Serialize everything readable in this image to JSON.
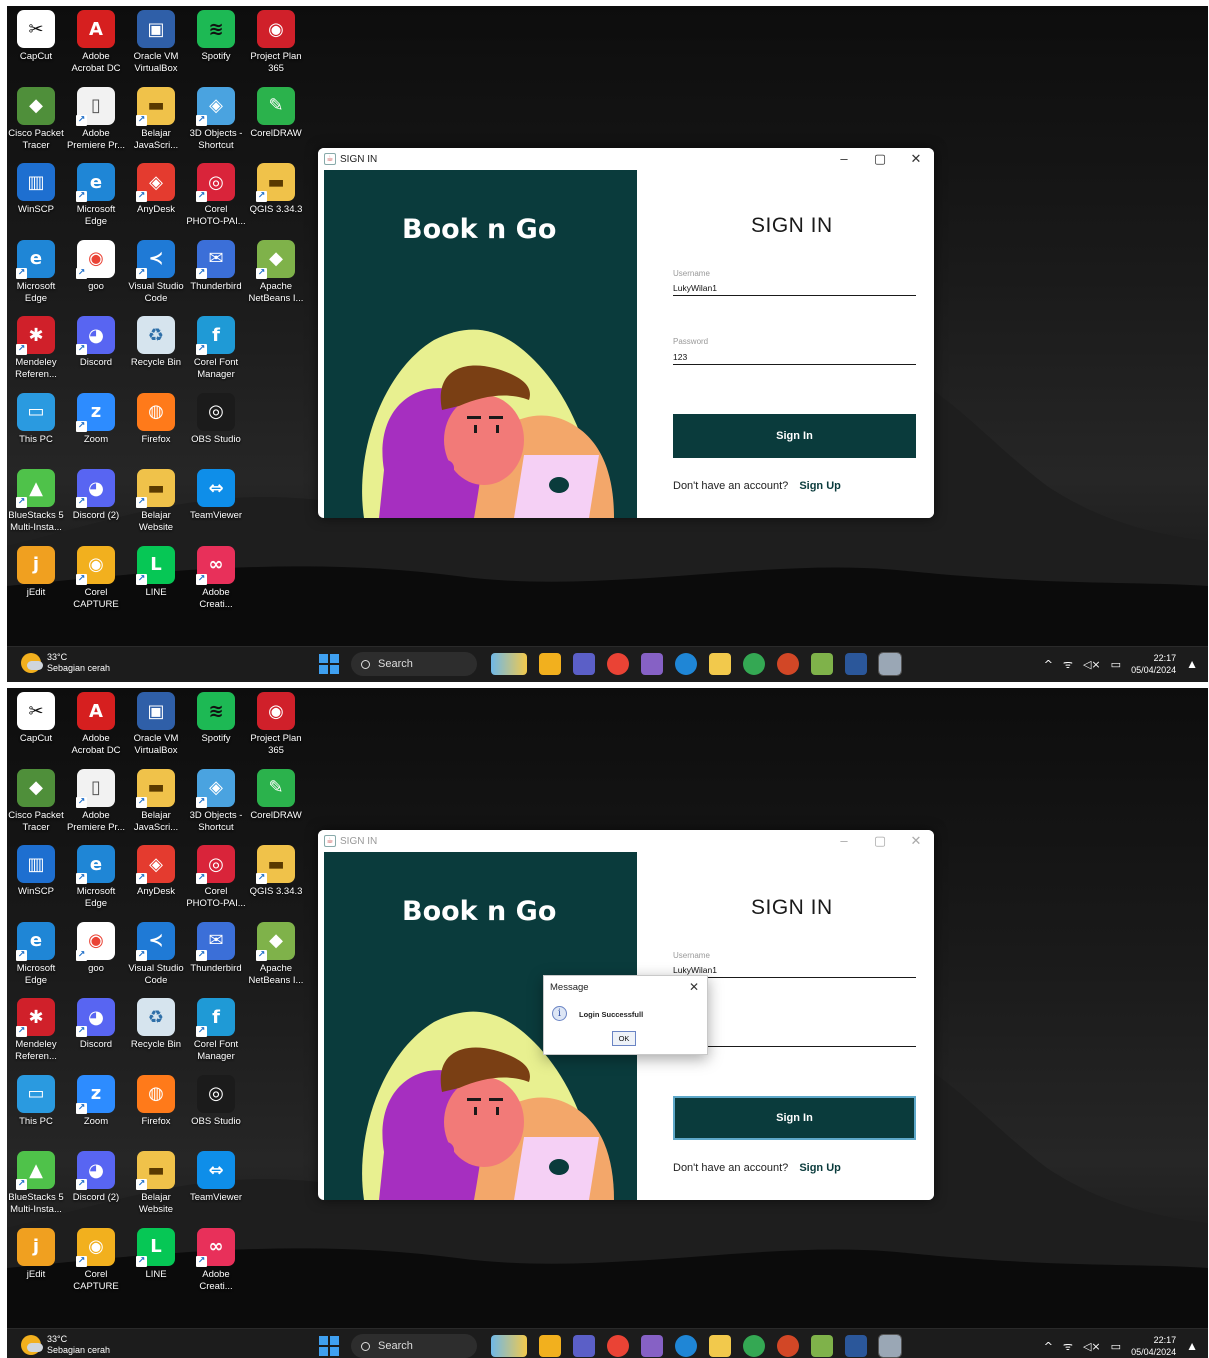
{
  "desktop": {
    "icons": [
      {
        "label": "CapCut",
        "color": "#ffffff",
        "fg": "#111111",
        "glyph": "✂"
      },
      {
        "label": "Adobe\nAcrobat DC",
        "color": "#d61f1f",
        "fg": "#ffffff",
        "glyph": "A"
      },
      {
        "label": "Oracle VM\nVirtualBox",
        "color": "#2f5fa8",
        "fg": "#ffffff",
        "glyph": "▣"
      },
      {
        "label": "Spotify",
        "color": "#1db954",
        "fg": "#111111",
        "glyph": "≋"
      },
      {
        "label": "Project Plan\n365",
        "color": "#d0202a",
        "fg": "#ffffff",
        "glyph": "◉"
      },
      {
        "label": "Cisco Packet\nTracer",
        "color": "#4f8f3a",
        "fg": "#ffffff",
        "glyph": "◆"
      },
      {
        "label": "Adobe\nPremiere Pr...",
        "color": "#f2f2f2",
        "fg": "#555555",
        "glyph": "▯"
      },
      {
        "label": "Belajar\nJavaScri...",
        "color": "#f0c24a",
        "fg": "#5a3a00",
        "glyph": "▬"
      },
      {
        "label": "3D Objects -\nShortcut",
        "color": "#4aa3e0",
        "fg": "#ffffff",
        "glyph": "◈"
      },
      {
        "label": "CorelDRAW",
        "color": "#2bb24c",
        "fg": "#ffffff",
        "glyph": "✎"
      },
      {
        "label": "WinSCP",
        "color": "#1e6fd0",
        "fg": "#ffffff",
        "glyph": "▥"
      },
      {
        "label": "Microsoft\nEdge",
        "color": "#1f86d6",
        "fg": "#ffffff",
        "glyph": "e"
      },
      {
        "label": "AnyDesk",
        "color": "#e43b2f",
        "fg": "#ffffff",
        "glyph": "◈"
      },
      {
        "label": "Corel\nPHOTO-PAI...",
        "color": "#d9243a",
        "fg": "#ffffff",
        "glyph": "◎"
      },
      {
        "label": "QGIS 3.34.3",
        "color": "#f0c24a",
        "fg": "#5a3a00",
        "glyph": "▬"
      },
      {
        "label": "Microsoft\nEdge",
        "color": "#1f86d6",
        "fg": "#ffffff",
        "glyph": "e"
      },
      {
        "label": "goo",
        "color": "#ffffff",
        "fg": "#ea4335",
        "glyph": "◉"
      },
      {
        "label": "Visual Studio\nCode",
        "color": "#1f7ad6",
        "fg": "#ffffff",
        "glyph": "≺"
      },
      {
        "label": "Thunderbird",
        "color": "#3b6fd8",
        "fg": "#ffffff",
        "glyph": "✉"
      },
      {
        "label": "Apache\nNetBeans I...",
        "color": "#7fb24a",
        "fg": "#ffffff",
        "glyph": "◆"
      },
      {
        "label": "Mendeley\nReferen...",
        "color": "#d0202a",
        "fg": "#ffffff",
        "glyph": "✱"
      },
      {
        "label": "Discord",
        "color": "#5865f2",
        "fg": "#ffffff",
        "glyph": "◕"
      },
      {
        "label": "Recycle Bin",
        "color": "#d6e4ee",
        "fg": "#2f6fa8",
        "glyph": "♻"
      },
      {
        "label": "Corel Font\nManager",
        "color": "#1f9ad6",
        "fg": "#ffffff",
        "glyph": "f"
      },
      {
        "label": "This PC",
        "color": "#2a9ae0",
        "fg": "#ffffff",
        "glyph": "▭"
      },
      {
        "label": "Zoom",
        "color": "#2d8cff",
        "fg": "#ffffff",
        "glyph": "z"
      },
      {
        "label": "Firefox",
        "color": "#ff7a1a",
        "fg": "#ffffff",
        "glyph": "◍"
      },
      {
        "label": "OBS Studio",
        "color": "#1b1b1b",
        "fg": "#ffffff",
        "glyph": "◎"
      },
      {
        "label": "BlueStacks 5\nMulti-Insta...",
        "color": "#4fc24a",
        "fg": "#ffffff",
        "glyph": "▲"
      },
      {
        "label": "Discord (2)",
        "color": "#5865f2",
        "fg": "#ffffff",
        "glyph": "◕"
      },
      {
        "label": "Belajar\nWebsite",
        "color": "#f0c24a",
        "fg": "#5a3a00",
        "glyph": "▬"
      },
      {
        "label": "TeamViewer",
        "color": "#0e8ee9",
        "fg": "#ffffff",
        "glyph": "⇔"
      },
      {
        "label": "jEdit",
        "color": "#f0a020",
        "fg": "#ffffff",
        "glyph": "j"
      },
      {
        "label": "Corel\nCAPTURE",
        "color": "#f2b01e",
        "fg": "#ffffff",
        "glyph": "◉"
      },
      {
        "label": "LINE",
        "color": "#06c755",
        "fg": "#ffffff",
        "glyph": "L"
      },
      {
        "label": "Adobe\nCreati...",
        "color": "#e8305a",
        "fg": "#ffffff",
        "glyph": "∞"
      }
    ]
  },
  "window": {
    "title": "SIGN IN",
    "brand": "Book n Go",
    "heading": "SIGN IN",
    "username_label": "Username",
    "username_value": "LukyWilan1",
    "password_label": "Password",
    "password_value": "123",
    "sign_in_button": "Sign In",
    "no_account_text": "Don't have an account?",
    "sign_up_link": "Sign Up",
    "minimize": "–",
    "maximize": "▢",
    "close": "✕"
  },
  "dialog": {
    "title": "Message",
    "close": "✕",
    "info_icon": "i",
    "message": "Login Successfull",
    "ok_button": "OK"
  },
  "taskbar": {
    "temperature": "33°C",
    "weather": "Sebagian cerah",
    "search_placeholder": "Search",
    "tray_chevron": "^",
    "tray_wifi": "ᯤ",
    "tray_sound": "◁×",
    "tray_battery": "▭",
    "time": "22:17",
    "date": "05/04/2024",
    "bell": "▲"
  },
  "colors": {
    "panel_dark": "#0a3b3c",
    "taskbar": "#1c1c1c"
  }
}
